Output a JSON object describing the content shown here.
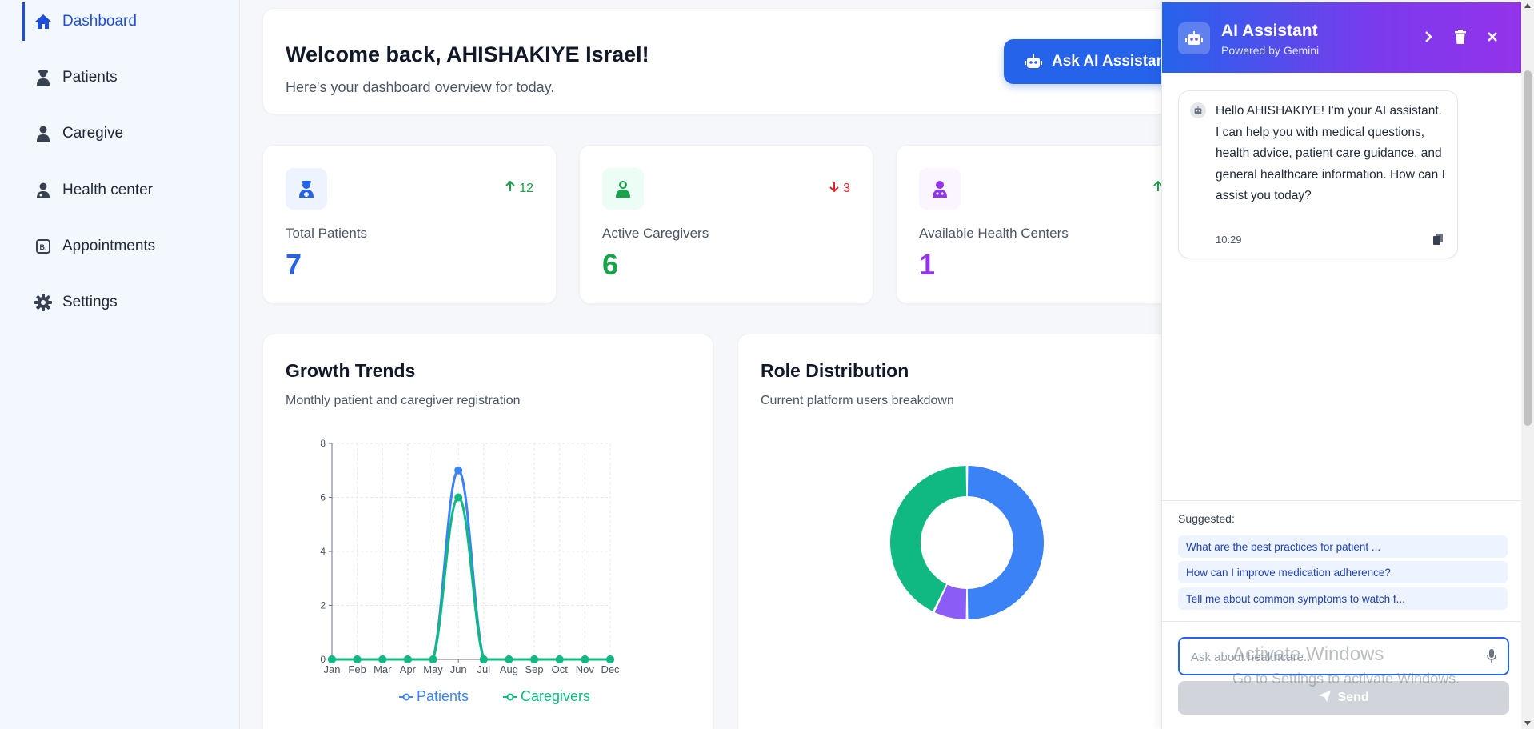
{
  "sidebar": {
    "items": [
      {
        "label": "Dashboard",
        "icon": "home-icon"
      },
      {
        "label": "Patients",
        "icon": "patient-icon"
      },
      {
        "label": "Caregive",
        "icon": "caregiver-icon"
      },
      {
        "label": "Health center",
        "icon": "doctor-icon"
      },
      {
        "label": "Appointments",
        "icon": "appointment-icon"
      },
      {
        "label": "Settings",
        "icon": "gear-icon"
      }
    ]
  },
  "welcome": {
    "title": "Welcome back, AHISHAKIYE Israel!",
    "subtitle": "Here's your dashboard overview for today.",
    "ask_button": "Ask AI Assistant"
  },
  "stats": [
    {
      "label": "Total Patients",
      "value": "7",
      "trend": "12",
      "trend_dir": "up",
      "color": "#2563eb"
    },
    {
      "label": "Active Caregivers",
      "value": "6",
      "trend": "3",
      "trend_dir": "down",
      "color": "#16a34a"
    },
    {
      "label": "Available Health Centers",
      "value": "1",
      "trend": "",
      "trend_dir": "up",
      "color": "#9333ea"
    }
  ],
  "growth": {
    "title": "Growth Trends",
    "subtitle": "Monthly patient and caregiver registration"
  },
  "roles": {
    "title": "Role Distribution",
    "subtitle": "Current platform users breakdown"
  },
  "chart_data": [
    {
      "type": "line",
      "title": "Growth Trends",
      "categories": [
        "Jan",
        "Feb",
        "Mar",
        "Apr",
        "May",
        "Jun",
        "Jul",
        "Aug",
        "Sep",
        "Oct",
        "Nov",
        "Dec"
      ],
      "series": [
        {
          "name": "Patients",
          "color": "#3b82f6",
          "values": [
            0,
            0,
            0,
            0,
            0,
            7,
            0,
            0,
            0,
            0,
            0,
            0
          ]
        },
        {
          "name": "Caregivers",
          "color": "#10b981",
          "values": [
            0,
            0,
            0,
            0,
            0,
            6,
            0,
            0,
            0,
            0,
            0,
            0
          ]
        }
      ],
      "ylim": [
        0,
        8
      ],
      "yticks": [
        0,
        2,
        4,
        6,
        8
      ],
      "grid": true,
      "legend": "bottom"
    },
    {
      "type": "pie",
      "title": "Role Distribution",
      "donut": true,
      "slices": [
        {
          "value": 7,
          "color": "#3b82f6"
        },
        {
          "value": 1,
          "color": "#8b5cf6"
        },
        {
          "value": 6,
          "color": "#10b981"
        }
      ]
    }
  ],
  "ai": {
    "title": "AI Assistant",
    "powered": "Powered by Gemini",
    "message": "Hello AHISHAKIYE! I'm your AI assistant. I can help you with medical questions, health advice, patient care guidance, and general healthcare information. How can I assist you today?",
    "time": "10:29",
    "suggested_label": "Suggested:",
    "suggestions": [
      "What are the best practices for patient ...",
      "How can I improve medication adherence?",
      "Tell me about common symptoms to watch f..."
    ],
    "input_placeholder": "Ask about healthcare...",
    "send_label": "Send"
  },
  "watermark": {
    "line1": "Activate Windows",
    "line2": "Go to Settings to activate Windows."
  }
}
